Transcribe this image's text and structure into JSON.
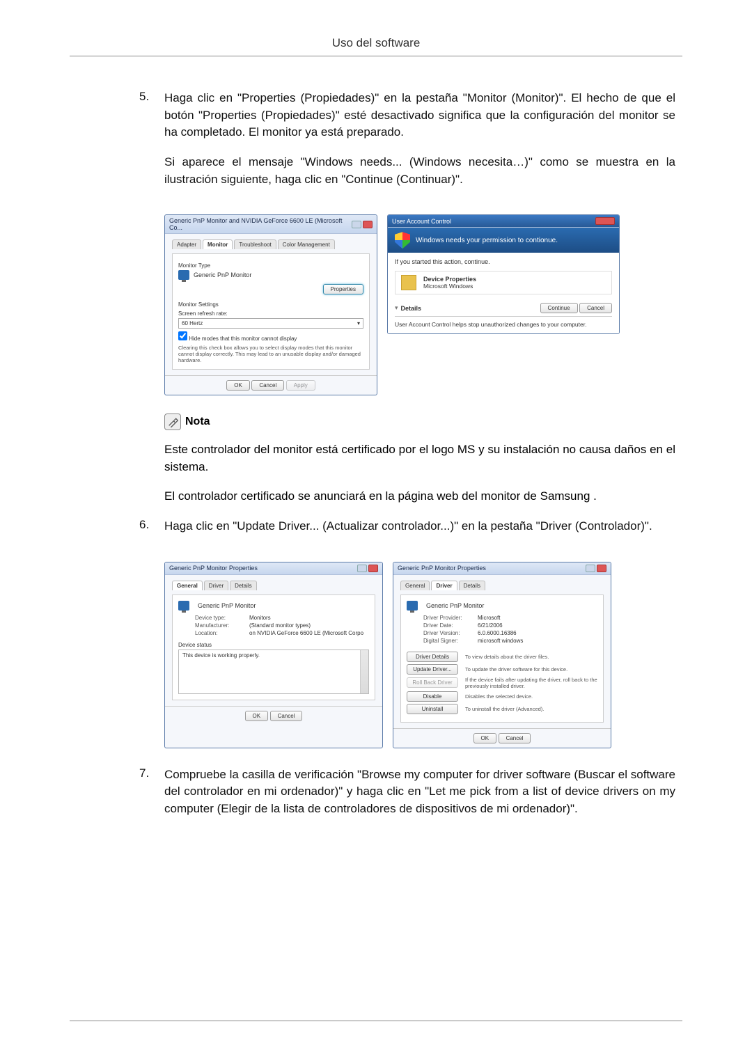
{
  "header": {
    "title": "Uso del software"
  },
  "steps": {
    "s5": {
      "num": "5.",
      "p1": "Haga clic en \"Properties (Propiedades)\" en la pestaña \"Monitor (Monitor)\". El hecho de que el botón \"Properties (Propiedades)\" esté desactivado significa que la configuración del monitor se ha completado. El monitor ya está preparado.",
      "p2": "Si aparece el mensaje \"Windows needs... (Windows necesita…)\" como se muestra en la ilustración siguiente, haga clic en \"Continue (Continuar)\"."
    },
    "s6": {
      "num": "6.",
      "p1": "Haga clic en \"Update Driver... (Actualizar controlador...)\" en la pestaña \"Driver (Controlador)\"."
    },
    "s7": {
      "num": "7.",
      "p1": "Compruebe la casilla de verificación \"Browse my computer for driver software (Buscar el software del controlador en mi ordenador)\" y haga clic en \"Let me pick from a list of device drivers on my computer (Elegir de la lista de controladores de dispositivos de mi ordenador)\"."
    }
  },
  "note": {
    "label": "Nota",
    "p1": "Este controlador del monitor está certificado por el logo MS y su instalación no causa daños en el sistema.",
    "p2": "El controlador certificado se anunciará en la página web del monitor de Samsung ."
  },
  "dlg_monitor": {
    "title": "Generic PnP Monitor and NVIDIA GeForce 6600 LE (Microsoft Co...",
    "tabs": {
      "adapter": "Adapter",
      "monitor": "Monitor",
      "troubleshoot": "Troubleshoot",
      "color": "Color Management"
    },
    "monitor_type_label": "Monitor Type",
    "monitor_name": "Generic PnP Monitor",
    "properties_btn": "Properties",
    "settings_label": "Monitor Settings",
    "refresh_label": "Screen refresh rate:",
    "refresh_value": "60 Hertz",
    "hide_modes": "Hide modes that this monitor cannot display",
    "hide_modes_desc": "Clearing this check box allows you to select display modes that this monitor cannot display correctly. This may lead to an unusable display and/or damaged hardware.",
    "ok": "OK",
    "cancel": "Cancel",
    "apply": "Apply"
  },
  "dlg_uac": {
    "title": "User Account Control",
    "headline": "Windows needs your permission to contionue.",
    "if_started": "If you started this action, continue.",
    "prop_name": "Device Properties",
    "publisher": "Microsoft Windows",
    "details": "Details",
    "continue": "Continue",
    "cancel": "Cancel",
    "footer": "User Account Control helps stop unauthorized changes to your computer."
  },
  "dlg_general": {
    "title": "Generic PnP Monitor Properties",
    "tabs": {
      "general": "General",
      "driver": "Driver",
      "details": "Details"
    },
    "name": "Generic PnP Monitor",
    "device_type_l": "Device type:",
    "device_type_v": "Monitors",
    "manufacturer_l": "Manufacturer:",
    "manufacturer_v": "(Standard monitor types)",
    "location_l": "Location:",
    "location_v": "on NVIDIA GeForce 6600 LE (Microsoft Corpo",
    "status_l": "Device status",
    "status_v": "This device is working properly.",
    "ok": "OK",
    "cancel": "Cancel"
  },
  "dlg_driver": {
    "title": "Generic PnP Monitor Properties",
    "tabs": {
      "general": "General",
      "driver": "Driver",
      "details": "Details"
    },
    "name": "Generic PnP Monitor",
    "provider_l": "Driver Provider:",
    "provider_v": "Microsoft",
    "date_l": "Driver Date:",
    "date_v": "6/21/2006",
    "version_l": "Driver Version:",
    "version_v": "6.0.6000.16386",
    "signer_l": "Digital Signer:",
    "signer_v": "microsoft windows",
    "btn_details": "Driver Details",
    "desc_details": "To view details about the driver files.",
    "btn_update": "Update Driver...",
    "desc_update": "To update the driver software for this device.",
    "btn_rollback": "Roll Back Driver",
    "desc_rollback": "If the device fails after updating the driver, roll back to the previously installed driver.",
    "btn_disable": "Disable",
    "desc_disable": "Disables the selected device.",
    "btn_uninstall": "Uninstall",
    "desc_uninstall": "To uninstall the driver (Advanced).",
    "ok": "OK",
    "cancel": "Cancel"
  }
}
